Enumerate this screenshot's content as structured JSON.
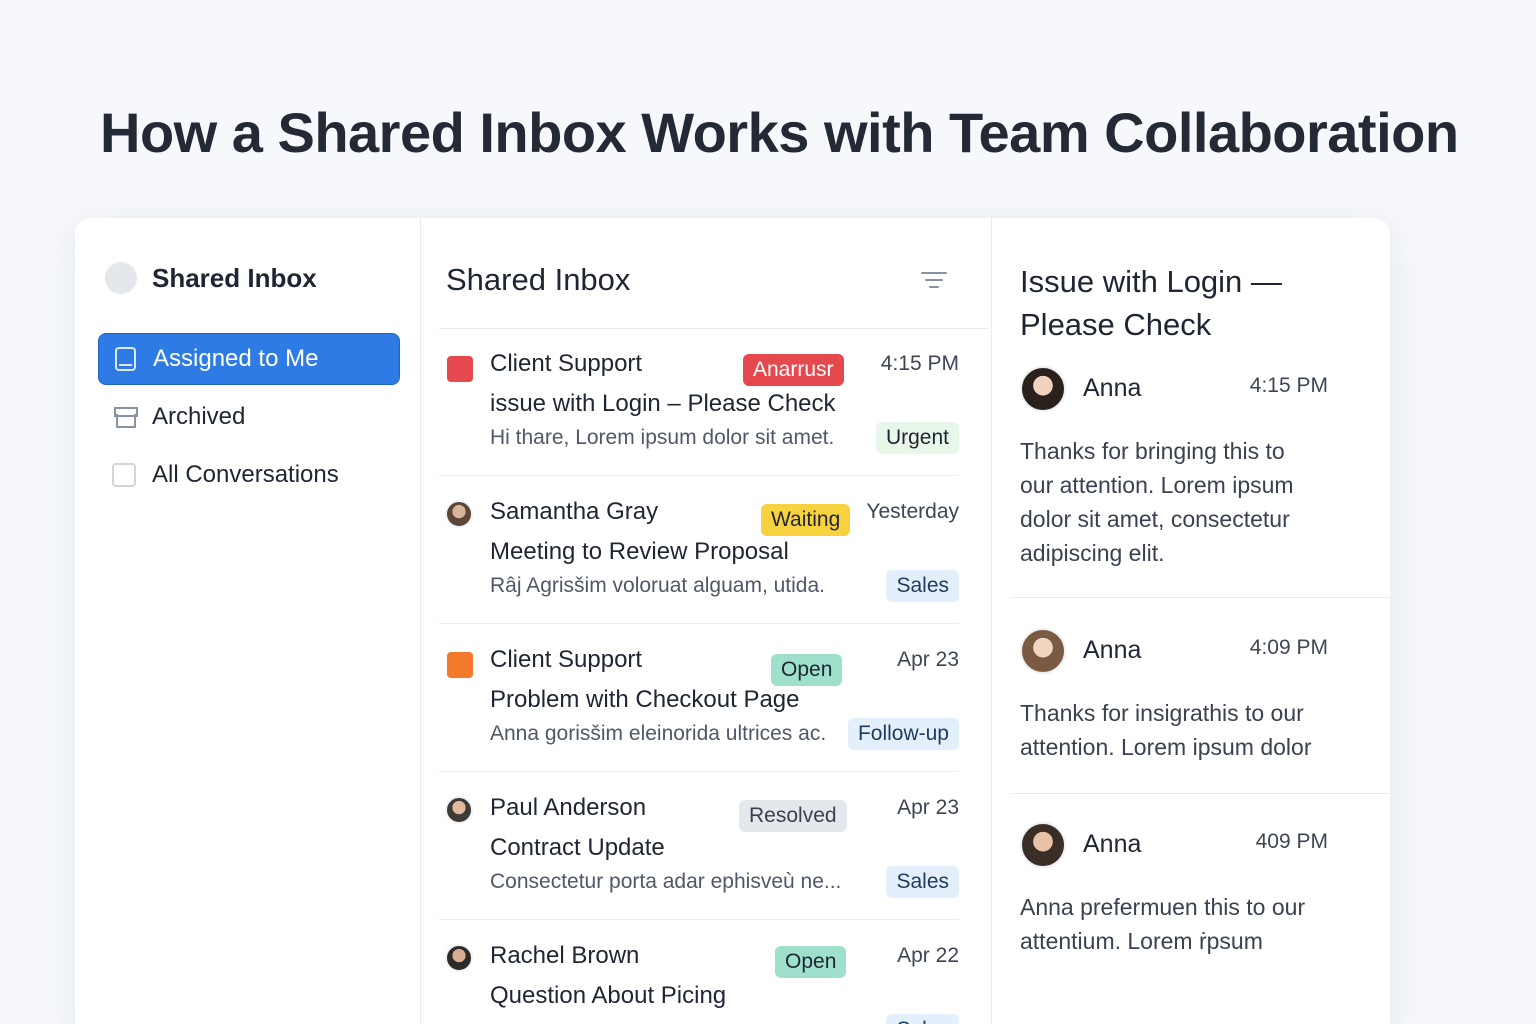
{
  "page": {
    "title": "How a Shared Inbox Works with Team Collaboration"
  },
  "sidebar": {
    "brand": "Shared Inbox",
    "items": [
      {
        "label": "Assigned to Me",
        "icon": "book-icon",
        "active": true
      },
      {
        "label": "Archived",
        "icon": "archive-icon",
        "active": false
      },
      {
        "label": "All Conversations",
        "icon": "checkbox-icon",
        "active": false
      }
    ]
  },
  "list": {
    "title": "Shared Inbox",
    "conversations": [
      {
        "sender": "Client Support",
        "subject": "issue with Login – Please Check",
        "preview": "Hi thare, Lorem ipsum dolor sit amet.",
        "time": "4:15 PM",
        "status": "Anarrusr",
        "tag": "Urgent",
        "marker": "red-square",
        "status_color": "#e5484d",
        "tag_color": "#e8f7e8"
      },
      {
        "sender": "Samantha Gray",
        "subject": "Meeting to Review Proposal",
        "preview": "Râj Agrisšim voloruat alguam, utida.",
        "time": "Yesterday",
        "status": "Waiting",
        "tag": "Sales",
        "marker": "avatar"
      },
      {
        "sender": "Client Support",
        "subject": "Problem with Checkout Page",
        "preview": "Anna gorisšim eleinorida ultrices ac.",
        "time": "Apr 23",
        "status": "Open",
        "tag": "Follow-up",
        "marker": "orange-square"
      },
      {
        "sender": "Paul Anderson",
        "subject": "Contract Update",
        "preview": "Consectetur porta adar ephisveù ne...",
        "time": "Apr 23",
        "status": "Resolved",
        "tag": "Sales",
        "marker": "avatar"
      },
      {
        "sender": "Rachel Brown",
        "subject": "Question About Picing",
        "preview": "",
        "time": "Apr 22",
        "status": "Open",
        "tag": "Sales",
        "marker": "avatar"
      }
    ]
  },
  "detail": {
    "title": "Issue with Login — Please Check",
    "messages": [
      {
        "name": "Anna",
        "time": "4:15 PM",
        "body": "Thanks for bringing this to our attention. Lorem ipsum dolor sit amet, consectetur adipiscing elit."
      },
      {
        "name": "Anna",
        "time": "4:09 PM",
        "body": "Thanks for insigrathis to our attention. Lorem ipsum dolor"
      },
      {
        "name": "Anna",
        "time": "409 PM",
        "body": "Anna prefermuen this to our attentium. Lorem ṙpsum"
      }
    ]
  },
  "colors": {
    "accent": "#2f7be5",
    "urgent_red": "#e5484d",
    "waiting_yellow": "#f7d23e",
    "open_teal": "#9fe0cc",
    "resolved_gray": "#e4e7ec",
    "tag_blue": "#e3f0fb"
  }
}
